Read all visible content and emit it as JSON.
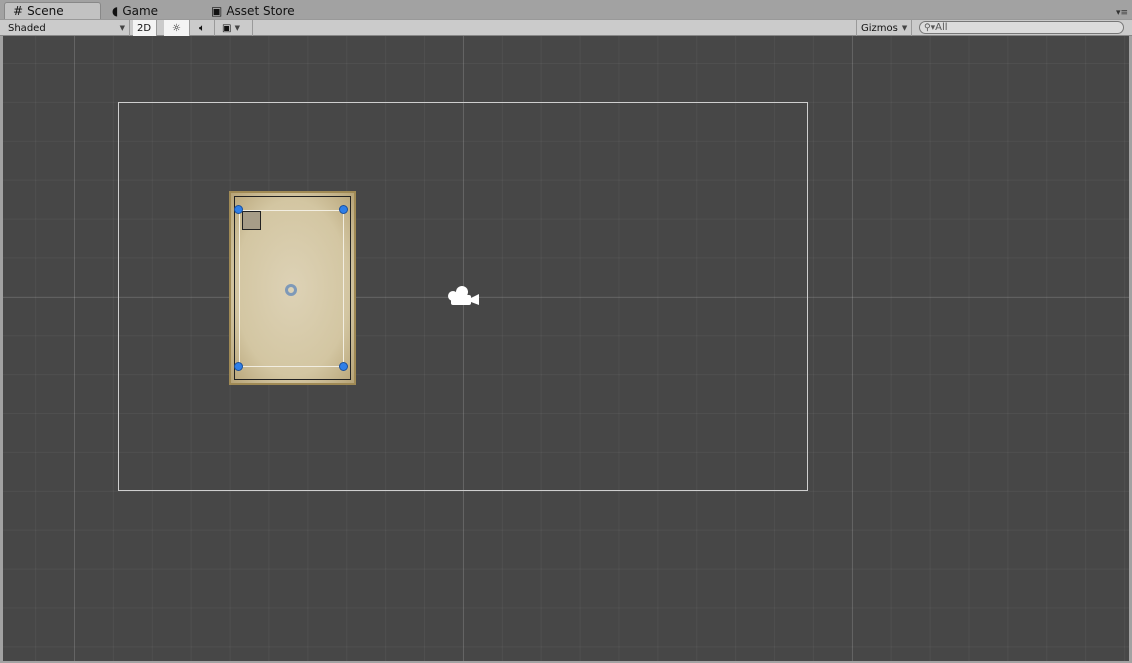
{
  "tabs": [
    {
      "label": "Scene",
      "icon": "grid-icon"
    },
    {
      "label": "Game",
      "icon": "pacman-icon"
    },
    {
      "label": "Asset Store",
      "icon": "bag-icon"
    }
  ],
  "toolbar": {
    "shading_mode": "Shaded",
    "mode_2d": "2D",
    "gizmos": "Gizmos",
    "search_placeholder": "All"
  }
}
